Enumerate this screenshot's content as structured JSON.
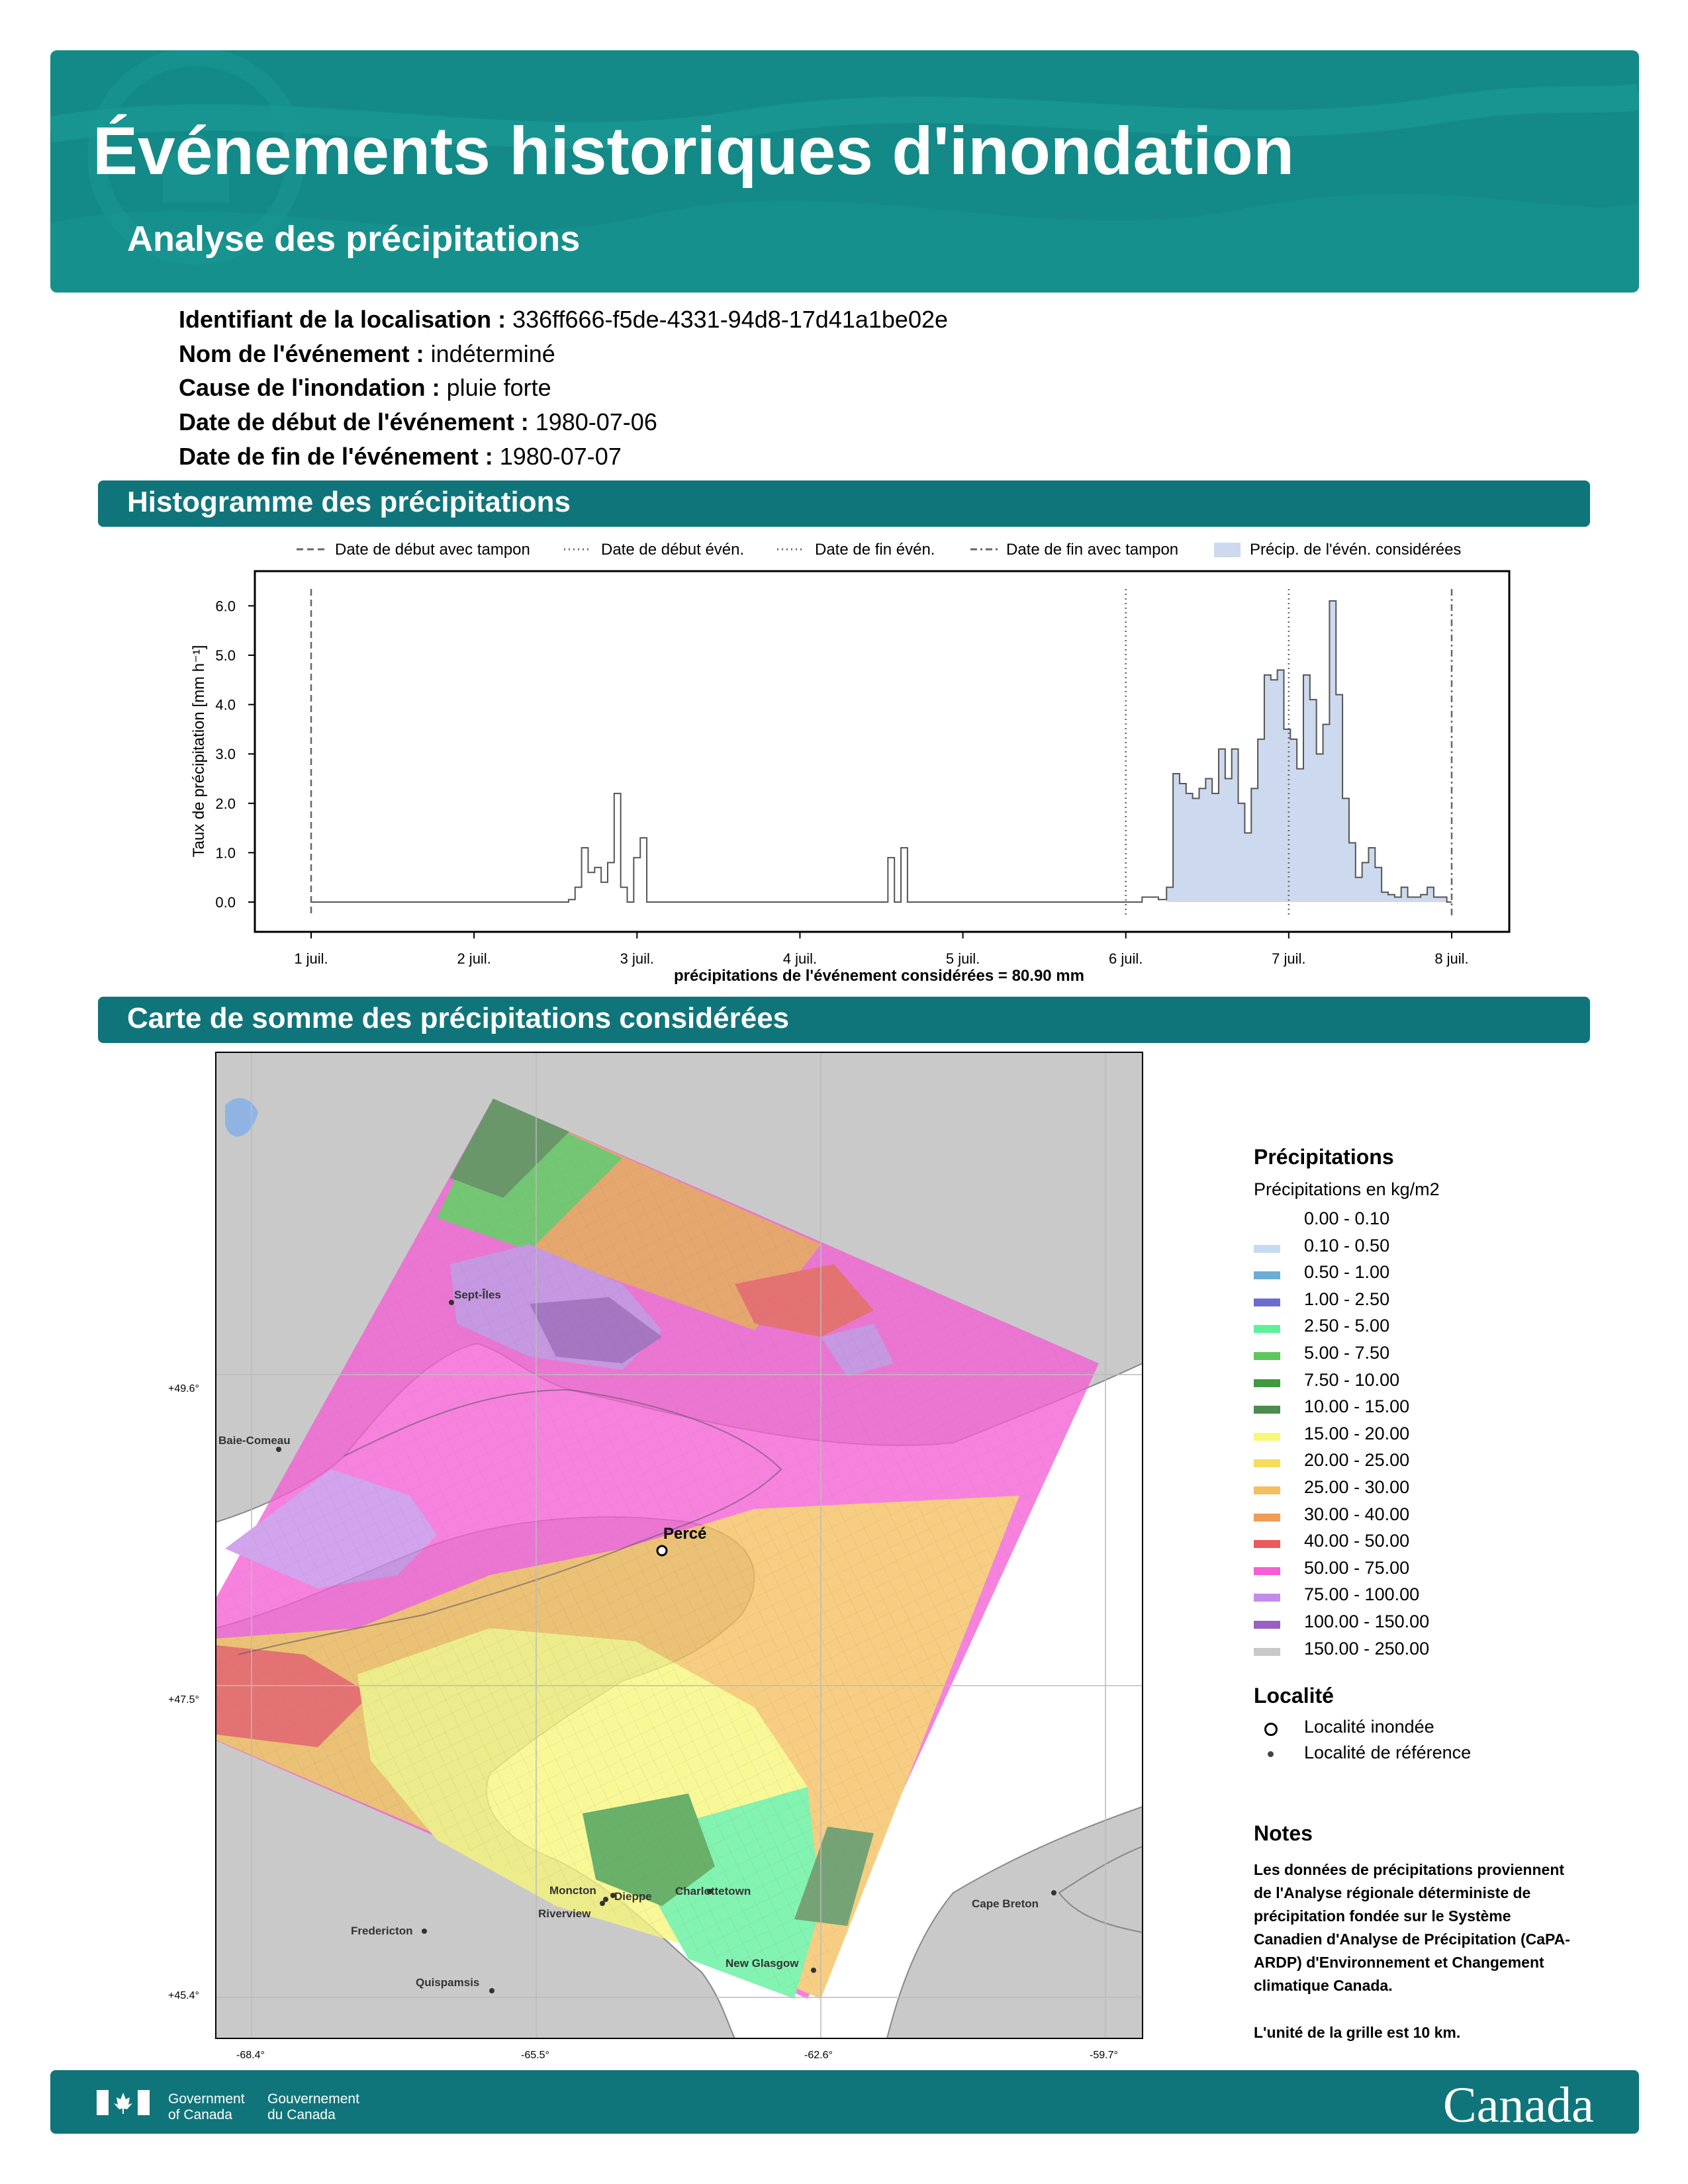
{
  "header": {
    "title": "Événements historiques d'inondation",
    "subtitle": "Analyse des précipitations"
  },
  "info": {
    "id_label": "Identifiant de la localisation :",
    "id_value": "336ff666-f5de-4331-94d8-17d41a1be02e",
    "name_label": "Nom de l'événement :",
    "name_value": "indéterminé",
    "cause_label": "Cause de l'inondation :",
    "cause_value": "pluie forte",
    "start_label": "Date de début de l'événement :",
    "start_value": "1980-07-06",
    "end_label": "Date de fin de l'événement :",
    "end_value": "1980-07-07"
  },
  "sections": {
    "histogram": "Histogramme des précipitations",
    "map": "Carte de somme des précipitations considérées"
  },
  "chart_data": {
    "type": "area",
    "ylabel": "Taux de précipitation [mm h⁻¹]",
    "xlabel": "précipitations de l'événement considérées = 80.90 mm",
    "ylim": [
      -0.4,
      6.7
    ],
    "yticks": [
      "0.0",
      "1.0",
      "2.0",
      "3.0",
      "4.0",
      "5.0",
      "6.0"
    ],
    "xticks": [
      "1 juil.",
      "2 juil.",
      "3 juil.",
      "4 juil.",
      "5 juil.",
      "6 juil.",
      "7 juil.",
      "8 juil."
    ],
    "legend": {
      "buffer_start": "Date de début avec tampon",
      "event_start": "Date de début évén.",
      "event_end": "Date de fin évén.",
      "buffer_end": "Date de fin avec tampon",
      "considered": "Précip. de l'évén. considérées"
    },
    "legend_placement": "top",
    "grid": false,
    "x_unit": "days since 1 juil. 00:00",
    "buffer_start_x": 0,
    "event_start_x": 5,
    "event_end_x": 6,
    "buffer_end_x": 7,
    "shade_from_x": 5.25,
    "shade_to_x": 7,
    "series": [
      {
        "x": 0.0,
        "y": 0.0
      },
      {
        "x": 1.5,
        "y": 0.0
      },
      {
        "x": 1.58,
        "y": 0.05
      },
      {
        "x": 1.62,
        "y": 0.3
      },
      {
        "x": 1.66,
        "y": 1.1
      },
      {
        "x": 1.7,
        "y": 0.6
      },
      {
        "x": 1.74,
        "y": 0.7
      },
      {
        "x": 1.78,
        "y": 0.4
      },
      {
        "x": 1.82,
        "y": 0.8
      },
      {
        "x": 1.86,
        "y": 2.2
      },
      {
        "x": 1.9,
        "y": 0.3
      },
      {
        "x": 1.94,
        "y": 0.0
      },
      {
        "x": 1.98,
        "y": 0.9
      },
      {
        "x": 2.02,
        "y": 1.3
      },
      {
        "x": 2.06,
        "y": 0.0
      },
      {
        "x": 3.5,
        "y": 0.0
      },
      {
        "x": 3.54,
        "y": 0.9
      },
      {
        "x": 3.58,
        "y": 0.0
      },
      {
        "x": 3.62,
        "y": 1.1
      },
      {
        "x": 3.66,
        "y": 0.0
      },
      {
        "x": 5.0,
        "y": 0.0
      },
      {
        "x": 5.1,
        "y": 0.1
      },
      {
        "x": 5.2,
        "y": 0.05
      },
      {
        "x": 5.25,
        "y": 0.3
      },
      {
        "x": 5.29,
        "y": 2.6
      },
      {
        "x": 5.33,
        "y": 2.4
      },
      {
        "x": 5.37,
        "y": 2.2
      },
      {
        "x": 5.41,
        "y": 2.1
      },
      {
        "x": 5.45,
        "y": 2.3
      },
      {
        "x": 5.49,
        "y": 2.5
      },
      {
        "x": 5.53,
        "y": 2.2
      },
      {
        "x": 5.57,
        "y": 3.1
      },
      {
        "x": 5.61,
        "y": 2.5
      },
      {
        "x": 5.65,
        "y": 3.1
      },
      {
        "x": 5.69,
        "y": 2.0
      },
      {
        "x": 5.73,
        "y": 1.4
      },
      {
        "x": 5.77,
        "y": 2.3
      },
      {
        "x": 5.81,
        "y": 3.3
      },
      {
        "x": 5.85,
        "y": 4.6
      },
      {
        "x": 5.89,
        "y": 4.5
      },
      {
        "x": 5.93,
        "y": 4.7
      },
      {
        "x": 5.97,
        "y": 3.5
      },
      {
        "x": 6.01,
        "y": 3.3
      },
      {
        "x": 6.05,
        "y": 2.7
      },
      {
        "x": 6.09,
        "y": 4.6
      },
      {
        "x": 6.13,
        "y": 4.1
      },
      {
        "x": 6.17,
        "y": 3.0
      },
      {
        "x": 6.21,
        "y": 3.6
      },
      {
        "x": 6.25,
        "y": 6.1
      },
      {
        "x": 6.29,
        "y": 4.2
      },
      {
        "x": 6.33,
        "y": 2.1
      },
      {
        "x": 6.37,
        "y": 1.2
      },
      {
        "x": 6.41,
        "y": 0.5
      },
      {
        "x": 6.45,
        "y": 0.8
      },
      {
        "x": 6.49,
        "y": 1.1
      },
      {
        "x": 6.53,
        "y": 0.7
      },
      {
        "x": 6.57,
        "y": 0.2
      },
      {
        "x": 6.61,
        "y": 0.15
      },
      {
        "x": 6.65,
        "y": 0.1
      },
      {
        "x": 6.69,
        "y": 0.3
      },
      {
        "x": 6.73,
        "y": 0.1
      },
      {
        "x": 6.77,
        "y": 0.1
      },
      {
        "x": 6.81,
        "y": 0.15
      },
      {
        "x": 6.85,
        "y": 0.3
      },
      {
        "x": 6.89,
        "y": 0.1
      },
      {
        "x": 6.93,
        "y": 0.1
      },
      {
        "x": 6.97,
        "y": 0.0
      }
    ]
  },
  "map": {
    "lat_labels": [
      "+49.6°",
      "+47.5°",
      "+45.4°"
    ],
    "lon_labels": [
      "-68.4°",
      "-65.5°",
      "-62.6°",
      "-59.7°"
    ],
    "places": {
      "sept_iles": "Sept-Îles",
      "baie_comeau": "Baie-Comeau",
      "perce": "Percé",
      "moncton": "Moncton",
      "dieppe": "Dieppe",
      "riverview": "Riverview",
      "charlottetown": "Charlottetown",
      "fredericton": "Fredericton",
      "quispamsis": "Quispamsis",
      "new_glasgow": "New Glasgow",
      "cape_breton": "Cape Breton"
    }
  },
  "legend": {
    "title": "Précipitations",
    "subtitle": "Précipitations en kg/m2",
    "classes": [
      {
        "label": "0.00 - 0.10",
        "color": "#ffffff"
      },
      {
        "label": "0.10 - 0.50",
        "color": "#c6dbef"
      },
      {
        "label": "0.50 - 1.00",
        "color": "#6baed6"
      },
      {
        "label": "1.00 - 2.50",
        "color": "#6b6ecf"
      },
      {
        "label": "2.50 - 5.00",
        "color": "#5ff09a"
      },
      {
        "label": "5.00 - 7.50",
        "color": "#5cc75c"
      },
      {
        "label": "7.50 - 10.00",
        "color": "#3f9a3f"
      },
      {
        "label": "10.00 - 15.00",
        "color": "#4f8a4f"
      },
      {
        "label": "15.00 - 20.00",
        "color": "#f7f77a"
      },
      {
        "label": "20.00 - 25.00",
        "color": "#f5dc5c"
      },
      {
        "label": "25.00 - 30.00",
        "color": "#f4bf5e"
      },
      {
        "label": "30.00 - 40.00",
        "color": "#ee9e55"
      },
      {
        "label": "40.00 - 50.00",
        "color": "#ec5a5a"
      },
      {
        "label": "50.00 - 75.00",
        "color": "#f45fd5"
      },
      {
        "label": "75.00 - 100.00",
        "color": "#c58be8"
      },
      {
        "label": "100.00 - 150.00",
        "color": "#9b5fc0"
      },
      {
        "label": "150.00 - 250.00",
        "color": "#c8c8c8"
      }
    ],
    "locality_title": "Localité",
    "flooded": "Localité inondée",
    "reference": "Localité de référence",
    "notes_title": "Notes",
    "notes_text": "Les données de précipitations proviennent de l'Analyse régionale déterministe de précipitation fondée sur le Système Canadien d'Analyse de Précipitation (CaPA-ARDP) d'Environnement et Changement climatique Canada.",
    "grid_note": "L'unité de la grille est 10 km."
  },
  "footer": {
    "gov_en_1": "Government",
    "gov_en_2": "of Canada",
    "gov_fr_1": "Gouvernement",
    "gov_fr_2": "du Canada",
    "wordmark": "Canada"
  }
}
